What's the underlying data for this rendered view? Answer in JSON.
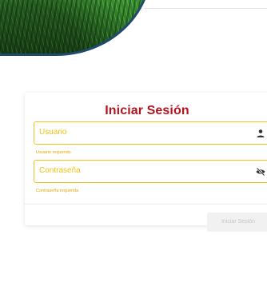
{
  "login": {
    "title": "Iniciar Sesión",
    "username": {
      "placeholder": "Usuario",
      "error": "Usuario requerido",
      "icon": "person-icon"
    },
    "password": {
      "placeholder": "Contraseña",
      "error": "Contraseña requerida",
      "icon": "eye-off-icon"
    },
    "submit_label": "Iniciar Sesión"
  },
  "colors": {
    "title": "#b3131e",
    "field_border": "#f0c21b",
    "error_text": "#e3a700",
    "button_disabled_bg": "#f1f1f1",
    "button_disabled_text": "#c6c6c6"
  }
}
